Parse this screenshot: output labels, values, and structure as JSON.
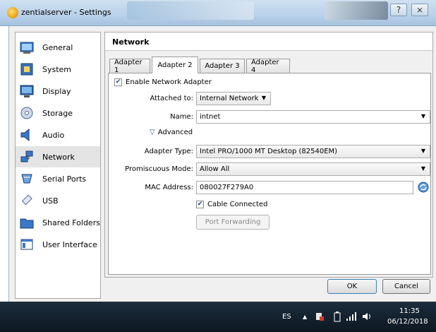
{
  "window": {
    "title": "zentialserver - Settings",
    "help_glyph": "?",
    "close_glyph": "⨯"
  },
  "sidebar": {
    "items": [
      {
        "label": "General"
      },
      {
        "label": "System"
      },
      {
        "label": "Display"
      },
      {
        "label": "Storage"
      },
      {
        "label": "Audio"
      },
      {
        "label": "Network",
        "selected": true
      },
      {
        "label": "Serial Ports"
      },
      {
        "label": "USB"
      },
      {
        "label": "Shared Folders"
      },
      {
        "label": "User Interface"
      }
    ]
  },
  "section": {
    "title": "Network"
  },
  "tabs": [
    "Adapter 1",
    "Adapter 2",
    "Adapter 3",
    "Adapter 4"
  ],
  "active_tab": "Adapter 2",
  "form": {
    "enable_label": "Enable Network Adapter",
    "enable_checked": "✔",
    "attached_label": "Attached to:",
    "attached_value": "Internal Network",
    "name_label": "Name:",
    "name_value": "intnet",
    "advanced_label": "Advanced",
    "advanced_arrow": "▽",
    "adapter_type_label": "Adapter Type:",
    "adapter_type_value": "Intel PRO/1000 MT Desktop (82540EM)",
    "promisc_label": "Promiscuous Mode:",
    "promisc_value": "Allow All",
    "mac_label": "MAC Address:",
    "mac_value": "080027F279A0",
    "cable_label": "Cable Connected",
    "cable_checked": "✔",
    "port_forwarding_label": "Port Forwarding",
    "dropdown_arrow": "▼"
  },
  "buttons": {
    "ok": "OK",
    "cancel": "Cancel"
  },
  "taskbar": {
    "language": "ES",
    "up_arrow": "▲",
    "time": "11:35",
    "date": "06/12/2018"
  },
  "colors": {
    "accent": "#1e5fa8",
    "titlebar": "#b9d1ea",
    "taskbar": "#1c2d3c"
  }
}
